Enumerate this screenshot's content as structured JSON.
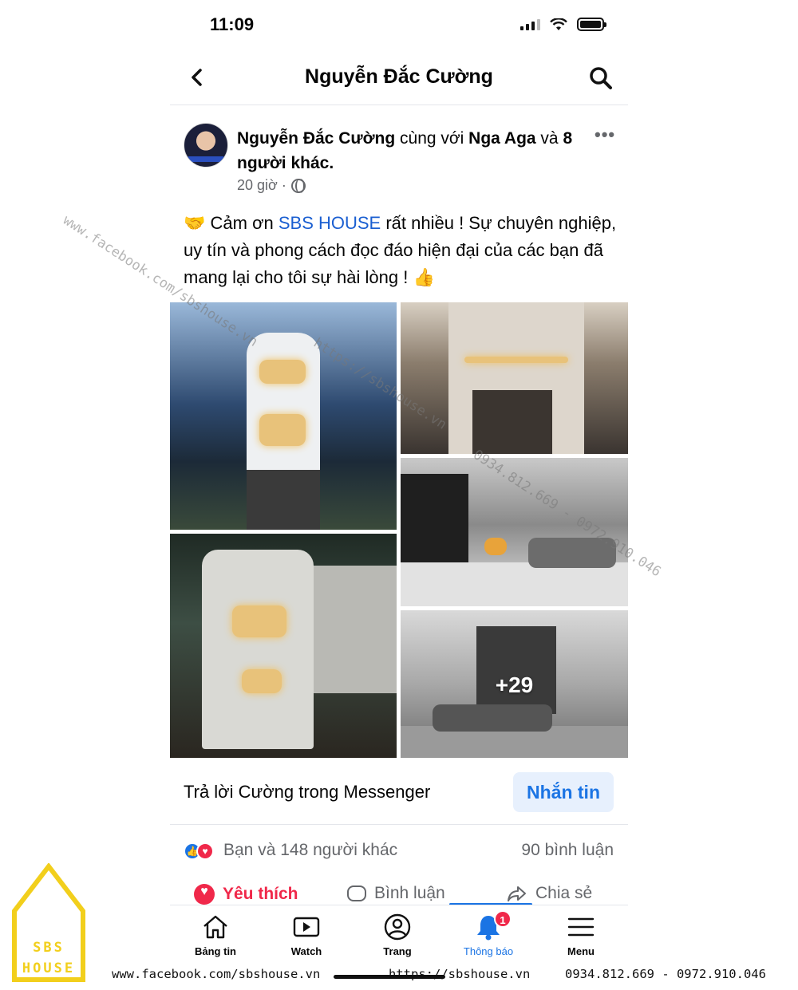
{
  "status_bar": {
    "time": "11:09"
  },
  "header": {
    "title": "Nguyễn Đắc Cường"
  },
  "post": {
    "author": "Nguyễn Đắc Cường",
    "with_text": "cùng với",
    "tagged": "Nga Aga",
    "and_text": "và",
    "others": "8 người khác.",
    "time": "20 giờ ·",
    "text_prefix": "🤝 Cảm ơn",
    "mention": "SBS HOUSE",
    "text_suffix": "rất nhiều ! Sự chuyên nghiệp, uy tín và phong cách đọc đáo hiện đại của các bạn đã mang lại cho tôi sự hài lòng ! 👍",
    "more_photos": "+29"
  },
  "messenger": {
    "reply_label": "Trả lời Cường trong Messenger",
    "button": "Nhắn tin"
  },
  "reactions": {
    "summary": "Bạn và 148 người khác",
    "comments": "90 bình luận"
  },
  "actions": {
    "like": "Yêu thích",
    "comment": "Bình luận",
    "share": "Chia sẻ"
  },
  "tabs": [
    {
      "label": "Bảng tin",
      "icon": "home-icon"
    },
    {
      "label": "Watch",
      "icon": "video-icon"
    },
    {
      "label": "Trang",
      "icon": "profile-icon"
    },
    {
      "label": "Thông báo",
      "icon": "bell-icon",
      "badge": "1"
    },
    {
      "label": "Menu",
      "icon": "menu-icon"
    }
  ],
  "watermark": {
    "logo_line1": "SBS",
    "logo_line2": "HOUSE",
    "facebook": "www.facebook.com/sbshouse.vn",
    "website": "https://sbshouse.vn",
    "phones": "0934.812.669 - 0972.910.046",
    "diag1": "www.facebook.com/sbshouse.vn",
    "diag2": "https://sbshouse.vn",
    "diag3": "0934.812.669 - 0972.910.046"
  },
  "colors": {
    "accent": "#1b74e4",
    "love": "#f0284a",
    "logo": "#f2cf1c"
  }
}
